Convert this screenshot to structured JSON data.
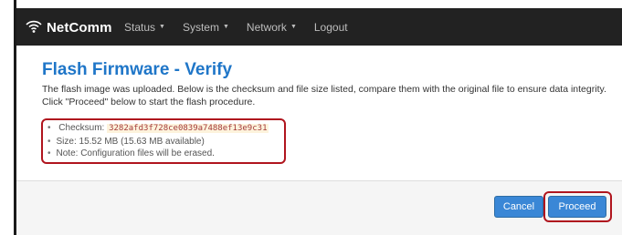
{
  "app": {
    "brand": "NetComm"
  },
  "nav": {
    "items": [
      {
        "label": "Status",
        "has_caret": true
      },
      {
        "label": "System",
        "has_caret": true
      },
      {
        "label": "Network",
        "has_caret": true
      },
      {
        "label": "Logout",
        "has_caret": false
      }
    ]
  },
  "page": {
    "title": "Flash Firmware - Verify",
    "description": "The flash image was uploaded. Below is the checksum and file size listed, compare them with the original file to ensure data integrity. Click \"Proceed\" below to start the flash procedure."
  },
  "info": {
    "checksum_label": "Checksum:",
    "checksum_value": "3282afd3f728ce0839a7488ef13e9c31",
    "size_text": "Size: 15.52 MB (15.63 MB available)",
    "note_text": "Note: Configuration files will be erased."
  },
  "buttons": {
    "cancel": "Cancel",
    "proceed": "Proceed"
  },
  "colors": {
    "navbar": "#222222",
    "title": "#1f76c8",
    "button": "#3a87d6",
    "highlight_border": "#b0151e"
  }
}
